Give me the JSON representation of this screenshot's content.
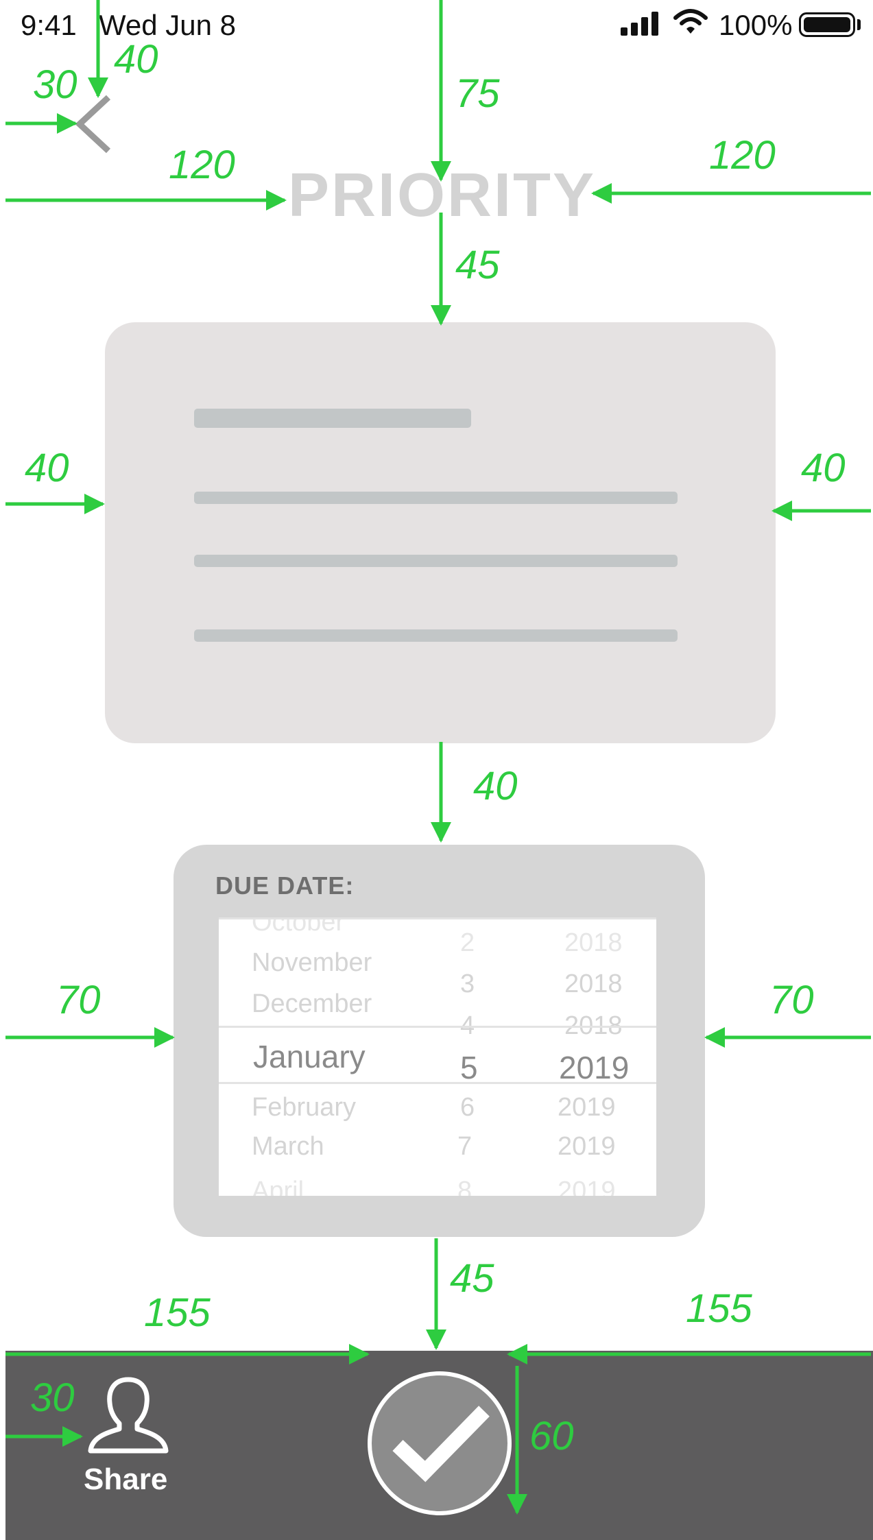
{
  "status_bar": {
    "time": "9:41",
    "date": "Wed Jun 8",
    "battery": "100%",
    "icons": [
      "signal-icon",
      "wifi-icon",
      "battery-icon"
    ]
  },
  "header": {
    "back_icon": "chevron-left-icon",
    "title": "PRIORITY"
  },
  "due_date": {
    "label": "DUE DATE:",
    "picker": {
      "months": [
        "October",
        "November",
        "December",
        "January",
        "February",
        "March",
        "April"
      ],
      "days": [
        "2",
        "3",
        "4",
        "5",
        "6",
        "7",
        "8"
      ],
      "years": [
        "2018",
        "2018",
        "2018",
        "2019",
        "2019",
        "2019",
        "2019"
      ],
      "selected": {
        "month": "January",
        "day": "5",
        "year": "2019"
      }
    }
  },
  "tab_bar": {
    "share_label": "Share",
    "share_icon": "user-icon",
    "confirm_icon": "checkmark-icon"
  },
  "annotations": {
    "back_left": "30",
    "back_top": "40",
    "title_top": "75",
    "title_left": "120",
    "title_right": "120",
    "card_top": "45",
    "card_left": "40",
    "card_right": "40",
    "due_top": "40",
    "due_left": "70",
    "due_right": "70",
    "tabbar_top": "45",
    "check_left": "155",
    "check_right": "155",
    "share_left": "30",
    "check_height": "60"
  },
  "colors": {
    "annotation": "#2ecc40",
    "tab_bar": "#5d5c5d",
    "card": "#e5e2e2",
    "due_box": "#d6d6d6",
    "title": "#d3d3d3"
  }
}
